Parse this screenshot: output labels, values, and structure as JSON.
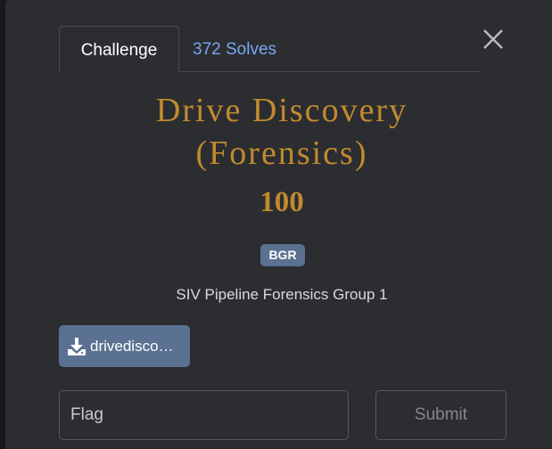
{
  "tabs": {
    "challenge_label": "Challenge",
    "solves_label": "372 Solves"
  },
  "challenge": {
    "title_line1": "Drive Discovery",
    "title_line2": "(Forensics)",
    "points": "100",
    "tag": "BGR",
    "description": "SIV Pipeline Forensics Group 1"
  },
  "file": {
    "label": "drivedisco…",
    "icon": "download-icon"
  },
  "flag_form": {
    "placeholder": "Flag",
    "value": "",
    "submit_label": "Submit"
  },
  "colors": {
    "title": "#c28a2e",
    "accent": "#5b7191",
    "link": "#79a6ec",
    "background": "#2b2d31"
  }
}
